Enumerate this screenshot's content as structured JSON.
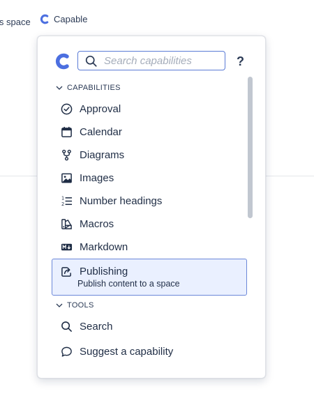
{
  "topbar": {
    "space_text": "is space",
    "brand_label": "Capable"
  },
  "colors": {
    "brand": "#4c6fe0",
    "selected_bg": "#eaf0ff",
    "selected_border": "#6b87d9"
  },
  "popup": {
    "search": {
      "placeholder": "Search capabilities",
      "value": ""
    },
    "help_label": "?",
    "sections": [
      {
        "title": "CAPABILITIES",
        "items": [
          {
            "label": "Approval",
            "icon": "check-circle-icon"
          },
          {
            "label": "Calendar",
            "icon": "calendar-icon"
          },
          {
            "label": "Diagrams",
            "icon": "branch-icon"
          },
          {
            "label": "Images",
            "icon": "image-icon"
          },
          {
            "label": "Number headings",
            "icon": "numbered-list-icon"
          },
          {
            "label": "Macros",
            "icon": "macros-icon"
          },
          {
            "label": "Markdown",
            "icon": "markdown-icon"
          },
          {
            "label": "Publishing",
            "icon": "share-icon",
            "description": "Publish content to a space",
            "selected": true
          }
        ]
      },
      {
        "title": "TOOLS",
        "items": [
          {
            "label": "Search",
            "icon": "search-icon"
          }
        ]
      }
    ],
    "suggest_label": "Suggest a capability"
  }
}
